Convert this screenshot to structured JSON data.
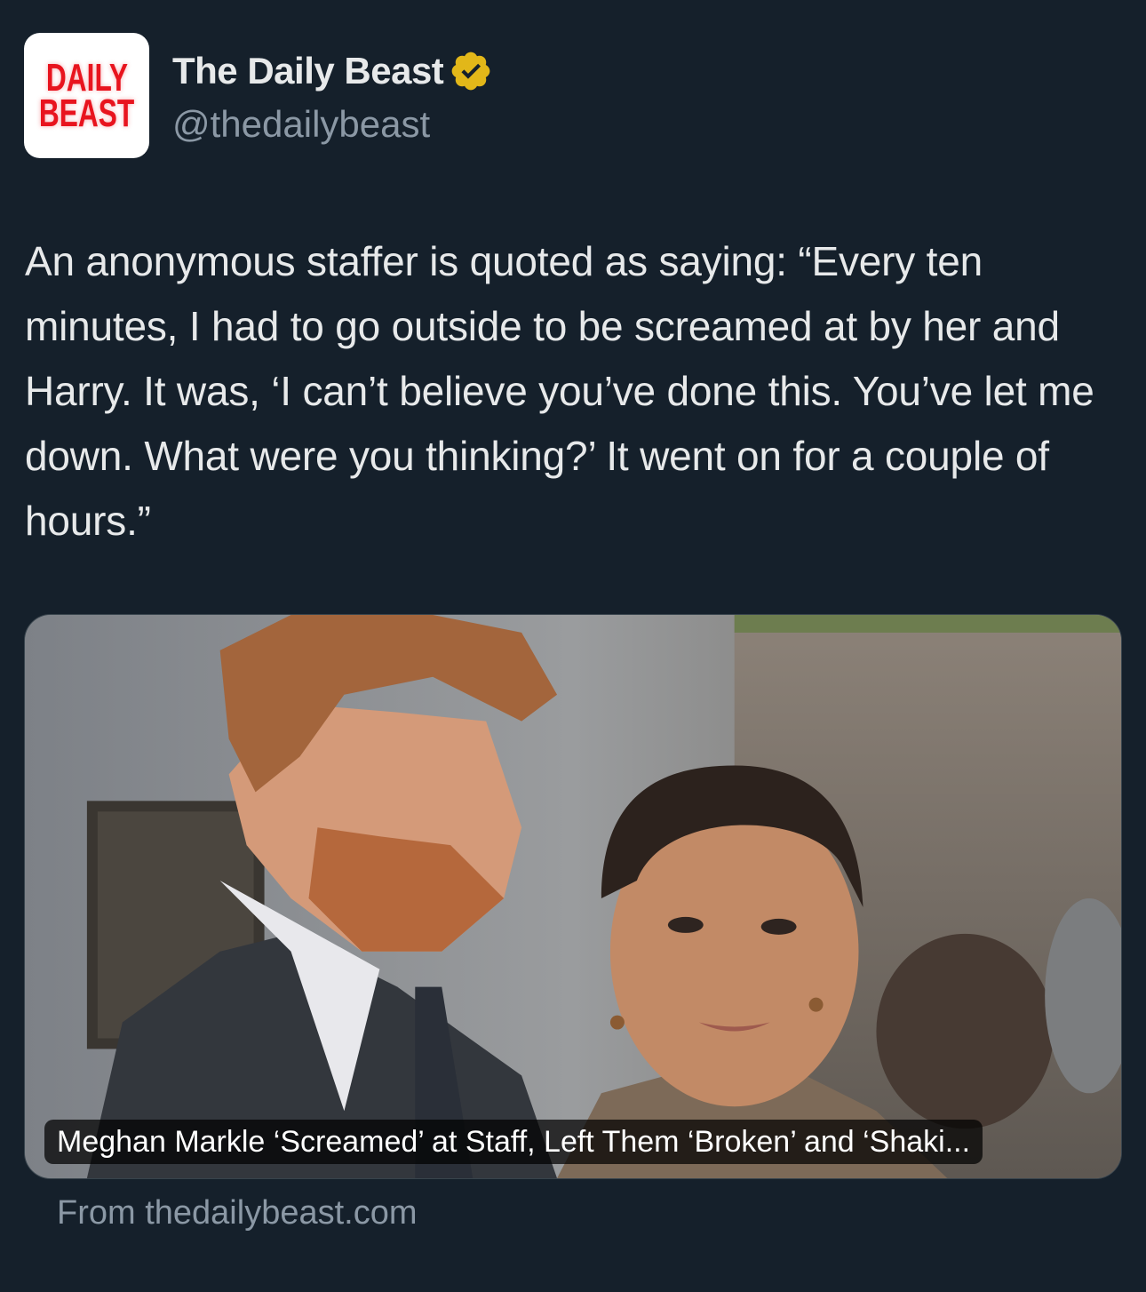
{
  "account": {
    "avatar_line1": "DAILY",
    "avatar_line2": "BEAST",
    "display_name": "The Daily Beast",
    "handle": "@thedailybeast",
    "verified_badge_color": "#e2b719"
  },
  "tweet": {
    "text": "An anonymous staffer is quoted as saying: “Every ten minutes, I had to go outside to be screamed at by her and Harry. It was, ‘I can’t believe you’ve done this. You’ve let me down. What were you thinking?’ It went on for a couple of hours.”"
  },
  "card": {
    "image_icon": "news-photo",
    "title": "Meghan Markle ‘Screamed’ at Staff, Left Them ‘Broken’ and ‘Shaki...",
    "source": "From thedailybeast.com"
  },
  "colors": {
    "background": "#15202b",
    "text_primary": "#e7e9ea",
    "text_secondary": "#8b98a5",
    "brand_red": "#e8141e"
  }
}
